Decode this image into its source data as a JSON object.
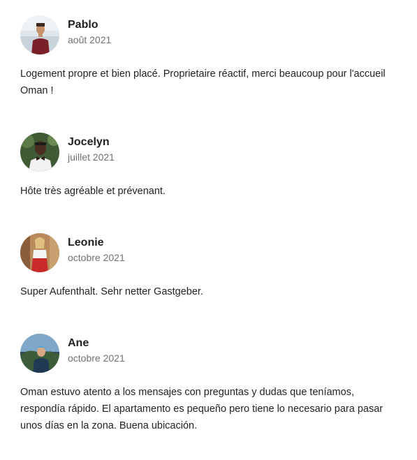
{
  "reviews": [
    {
      "name": "Pablo",
      "date": "août 2021",
      "text": "Logement propre et bien placé. Proprietaire réactif, merci beaucoup pour l'accueil Oman !",
      "avatar_icon": "avatar-photo"
    },
    {
      "name": "Jocelyn",
      "date": "juillet 2021",
      "text": "Hôte très agréable et prévenant.",
      "avatar_icon": "avatar-photo"
    },
    {
      "name": "Leonie",
      "date": "octobre 2021",
      "text": "Super Aufenthalt. Sehr netter Gastgeber.",
      "avatar_icon": "avatar-photo"
    },
    {
      "name": "Ane",
      "date": "octobre 2021",
      "text": "Oman estuvo atento a los mensajes con preguntas y dudas que teníamos, respondía rápido. El apartamento es pequeño pero tiene lo necesario para pasar unos días en la zona. Buena ubicación.",
      "avatar_icon": "avatar-photo"
    }
  ],
  "colors": {
    "text": "#222222",
    "muted": "#717171"
  }
}
